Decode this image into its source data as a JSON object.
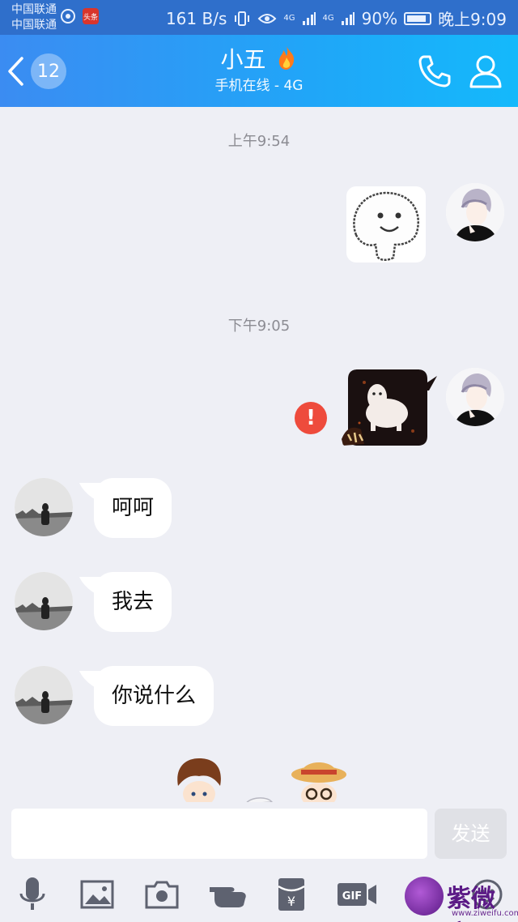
{
  "status_bar": {
    "carrier_1": "中国联通",
    "carrier_2": "中国联通",
    "app_badge": "头条",
    "network_speed": "161 B/s",
    "signal_1": "4G",
    "signal_2": "4G",
    "battery": "90%",
    "battery_level": 0.9,
    "time": "晚上9:09"
  },
  "header": {
    "unread_count": "12",
    "title": "小五",
    "subtitle": "手机在线 - 4G",
    "icons": [
      "back-icon",
      "fire-icon",
      "phone-icon",
      "profile-icon"
    ]
  },
  "messages": [
    {
      "type": "timestamp",
      "text": "上午9:54"
    },
    {
      "type": "sticker",
      "from": "me",
      "content": "smiley-face-sticker"
    },
    {
      "type": "timestamp",
      "text": "下午9:05"
    },
    {
      "type": "sticker",
      "from": "me",
      "content": "alpaca-sticker",
      "status": "failed",
      "status_glyph": "!"
    },
    {
      "type": "text",
      "from": "them",
      "text": "呵呵"
    },
    {
      "type": "text",
      "from": "them",
      "text": "我去"
    },
    {
      "type": "text",
      "from": "them",
      "text": "你说什么"
    }
  ],
  "input": {
    "value": "",
    "placeholder": "",
    "send_label": "发送"
  },
  "toolbar": {
    "items": [
      "microphone-icon",
      "image-icon",
      "camera-icon",
      "hand-point-icon",
      "red-packet-icon",
      "gif-icon",
      "emoji-icon"
    ],
    "gif_label": "GIF",
    "red_packet_symbol": "¥"
  },
  "watermark": {
    "name": "紫微府",
    "url": "www.ziweifu.com"
  },
  "colors": {
    "header_start": "#3b8cf2",
    "header_end": "#14b9fb",
    "chat_bg": "#eeeff5",
    "error": "#ee4b3c"
  }
}
